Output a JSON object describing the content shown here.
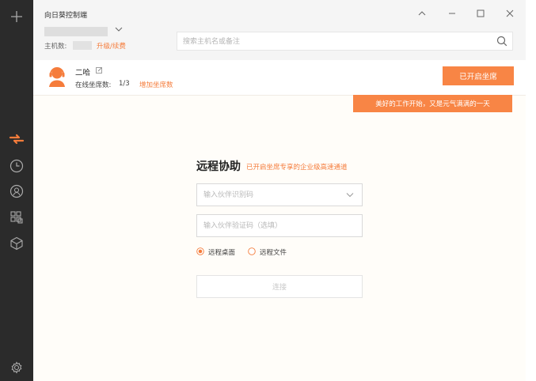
{
  "app": {
    "title": "向日葵控制端"
  },
  "account": {
    "host_count_label": "主机数:",
    "upgrade_link": "升级/续费"
  },
  "search": {
    "placeholder": "搜索主机名或备注"
  },
  "seat": {
    "user_name": "二哈",
    "online_label": "在线坐席数:",
    "online_value": "1/3",
    "add_link": "增加坐席数",
    "status_button": "已开启坐席",
    "greeting": "美好的工作开始，又是元气满满的一天"
  },
  "remote": {
    "title": "远程协助",
    "subtitle": "已开启坐席专享的企业级高速通道",
    "partner_code_placeholder": "输入伙伴识别码",
    "verify_code_placeholder": "输入伙伴验证码（选填）",
    "options": [
      {
        "label": "远程桌面",
        "selected": true
      },
      {
        "label": "远程文件",
        "selected": false
      }
    ],
    "connect_label": "连接"
  },
  "colors": {
    "accent": "#f88545",
    "sidebar": "#2b2b2b",
    "active_icon": "#f57c3b"
  }
}
